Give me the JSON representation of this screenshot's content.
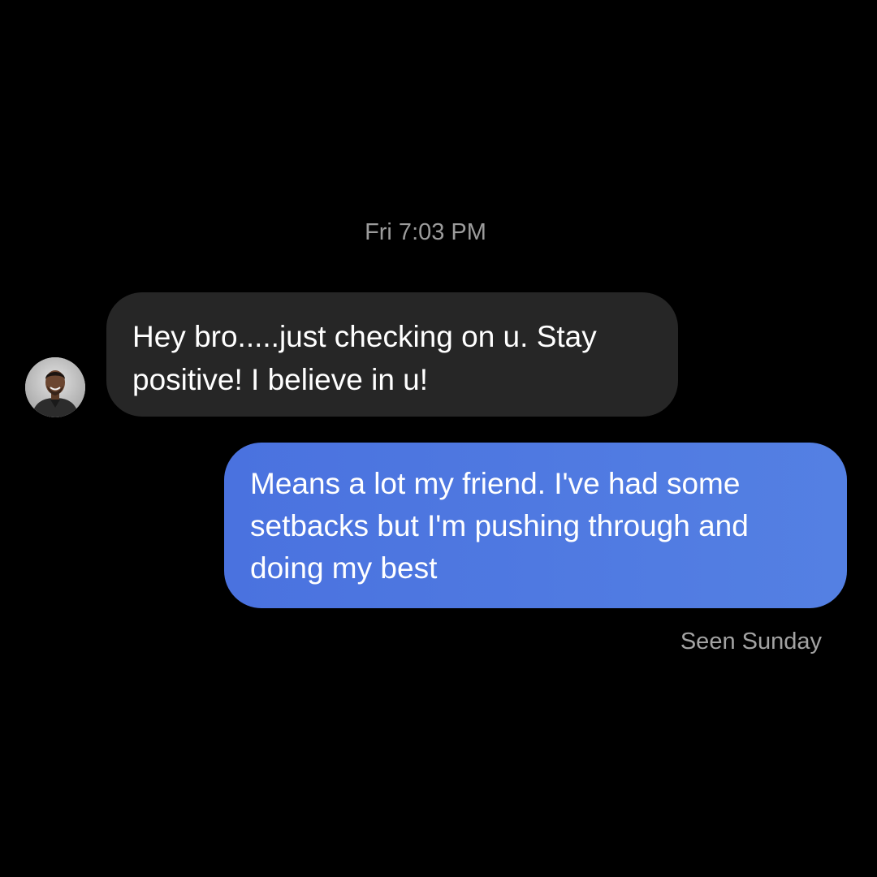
{
  "conversation": {
    "timestamp": "Fri 7:03 PM",
    "messages": [
      {
        "direction": "incoming",
        "text": "Hey bro.....just checking on u. Stay positive! I believe in u!"
      },
      {
        "direction": "outgoing",
        "text": "Means a lot my friend. I've had some setbacks but I'm pushing through and doing my best"
      }
    ],
    "read_receipt": "Seen Sunday"
  },
  "colors": {
    "background": "#000000",
    "incoming_bubble": "#262626",
    "outgoing_bubble": "#4f7be2",
    "meta_text": "#9c9c9c"
  }
}
